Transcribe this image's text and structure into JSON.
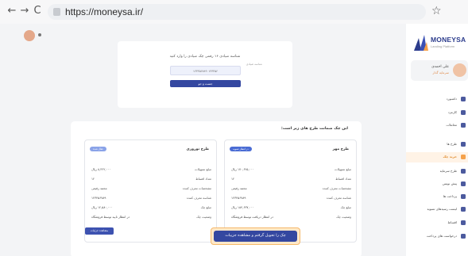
{
  "browser": {
    "url": "https://moneysa.ir/",
    "back_icon": "←",
    "forward_icon": "→",
    "reload_icon": "C",
    "star_icon": "☆"
  },
  "sidebar": {
    "logo_text": "MONEYSA",
    "logo_sub": "Landing Platform",
    "user": {
      "name": "علی احمدی",
      "role": "سرمایه گذار"
    },
    "items": [
      {
        "label": "داشبورد"
      },
      {
        "label": "کارمزد"
      },
      {
        "label": "معاملات"
      },
      {
        "label": "طرح ها"
      },
      {
        "label": "خرید چک",
        "active": true
      },
      {
        "label": "طرح سرمایه"
      },
      {
        "label": "پیش نویس"
      },
      {
        "label": "پرداخت ها"
      },
      {
        "label": "لیست رسیدهای تسویه"
      },
      {
        "label": "اقساط"
      },
      {
        "label": "درخواست های پرداخت"
      }
    ]
  },
  "code_card": {
    "title": "شناسه صیادی ۱۶ رقمی چک صیادی را وارد کنید",
    "input_label": "شناسه صیادی",
    "input_value": "۱۲۳۴۵۶۷۸۹۰۱۲۳۴۵۶",
    "submit_label": "جست و جو"
  },
  "plans": {
    "title": "این چک ضمانت طرح های زیر است:",
    "items": [
      {
        "name": "طرح مهر",
        "badge": "در انتظار تسویه",
        "badge_color": "#4a6cd4",
        "rows": [
          {
            "k": "مبلغ تسهیلات",
            "v": "۱۷۰,۶۲۵,۰۰۰ ریال"
          },
          {
            "k": "تعداد اقساط",
            "v": "۱۲"
          },
          {
            "k": "مشخصات معرف کننده",
            "v": "محمد رفیعی"
          },
          {
            "k": "شناسه معرف کننده",
            "v": "۱۲۳۴۵۶۷۸۹"
          },
          {
            "k": "مبلغ چک",
            "v": "۱۸۴,۶۳۷,۰۰۰ ریال"
          },
          {
            "k": "وضعیت چک",
            "v": "در انتظار دریافت توسط فروشگاه"
          }
        ]
      },
      {
        "name": "طرح نوروزی",
        "badge": "فعال شده",
        "badge_color": "#8aa3e8",
        "rows": [
          {
            "k": "مبلغ تسهیلات",
            "v": "۸,۳۶۲,۰۰۰ ریال"
          },
          {
            "k": "تعداد اقساط",
            "v": "۱۲"
          },
          {
            "k": "مشخصات معرف کننده",
            "v": "محمد رفیعی"
          },
          {
            "k": "شناسه معرف کننده",
            "v": "۱۲۳۴۵۶۷۸۹"
          },
          {
            "k": "مبلغ چک",
            "v": "۱۲,۵۸۰,۰۰۰ ریال"
          },
          {
            "k": "وضعیت چک",
            "v": "در انتظار تایید توسط فروشگاه"
          }
        ]
      }
    ],
    "detail_button": "مشاهده جزئیات"
  },
  "cta": {
    "label": "چک را تحویل گرفتم و مشاهده جزییات"
  }
}
